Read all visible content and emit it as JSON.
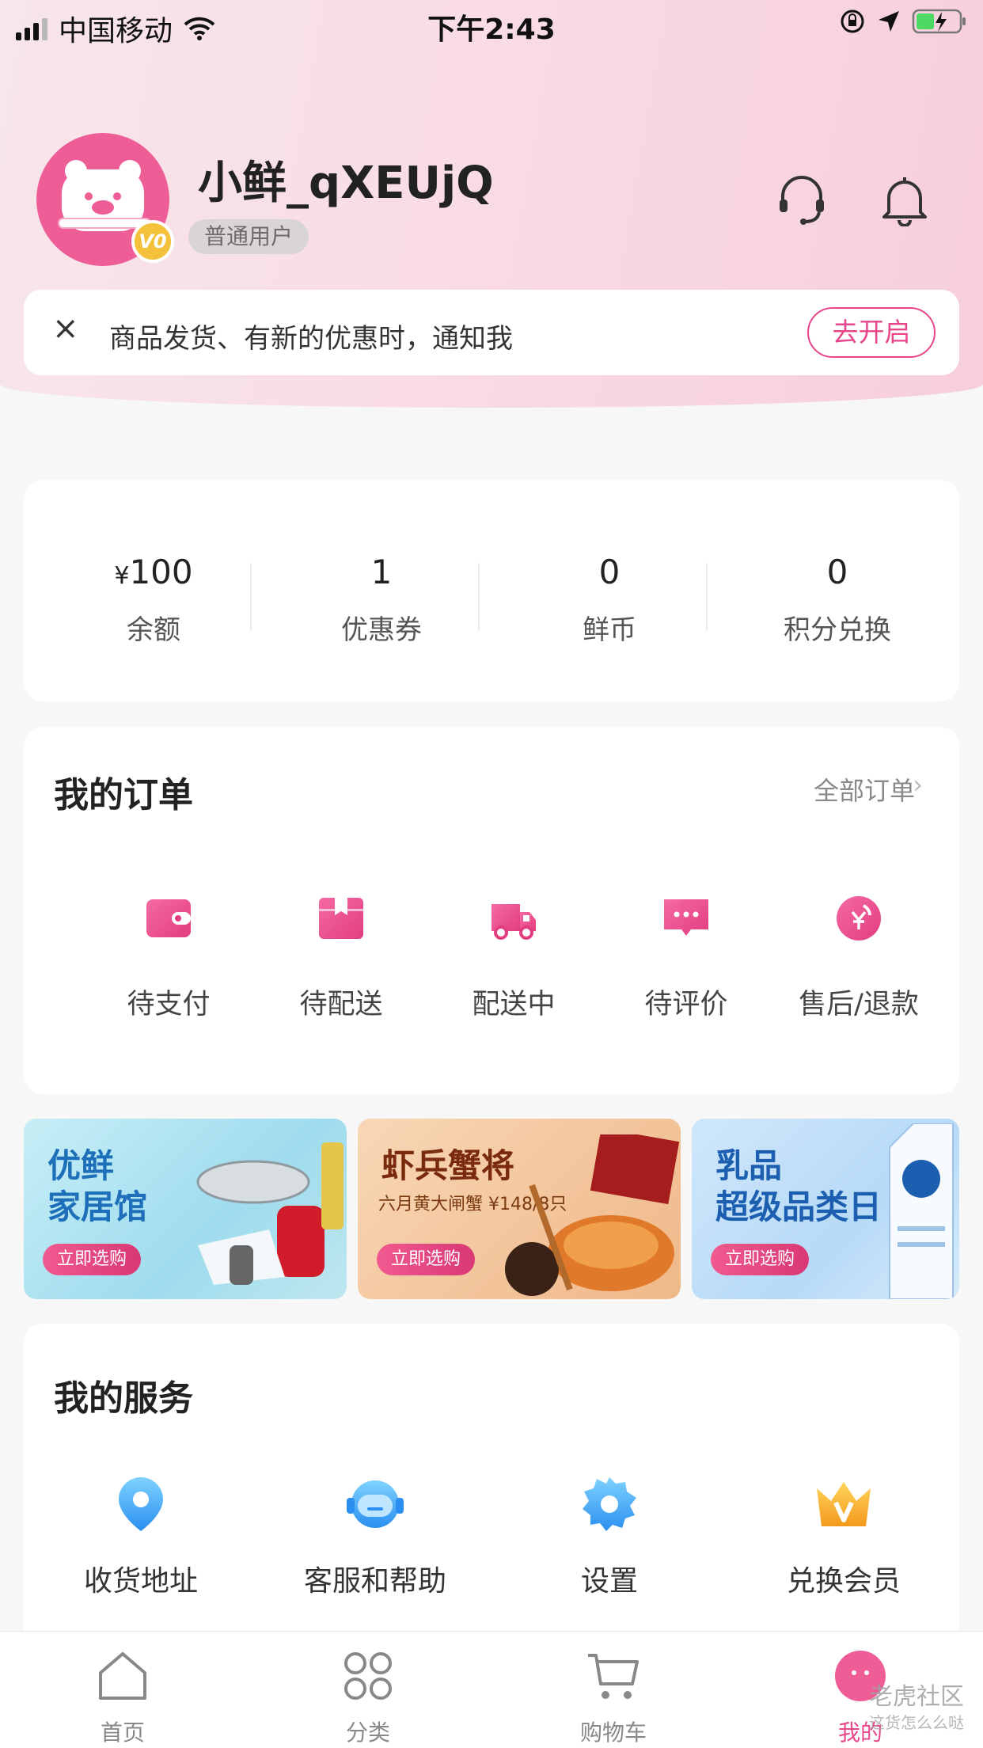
{
  "status_bar": {
    "carrier": "中国移动",
    "time": "下午2:43"
  },
  "profile": {
    "username": "小鲜_qXEUjQ",
    "user_type": "普通用户",
    "level": "V0"
  },
  "notify": {
    "text": "商品发货、有新的优惠时，通知我",
    "button": "去开启",
    "close": "×"
  },
  "assets": {
    "items": [
      {
        "currency": "¥",
        "value": "100",
        "label": "余额"
      },
      {
        "value": "1",
        "label": "优惠券"
      },
      {
        "value": "0",
        "label": "鲜币"
      },
      {
        "value": "0",
        "label": "积分兑换"
      }
    ]
  },
  "orders": {
    "title": "我的订单",
    "all_link": "全部订单",
    "items": [
      {
        "label": "待支付",
        "icon": "wallet-icon"
      },
      {
        "label": "待配送",
        "icon": "package-icon"
      },
      {
        "label": "配送中",
        "icon": "truck-icon"
      },
      {
        "label": "待评价",
        "icon": "comment-icon"
      },
      {
        "label": "售后/退款",
        "icon": "refund-icon"
      }
    ]
  },
  "banners": [
    {
      "title_line1": "优鲜",
      "title_line2": "家居馆",
      "button": "立即选购",
      "color": "#1c6fb8"
    },
    {
      "title_line1": "虾兵蟹将",
      "subtitle": "六月黄大闸蟹 ¥148/8只",
      "button": "立即选购",
      "color": "#7a2a0d"
    },
    {
      "title_line1": "乳品",
      "title_line2": "超级品类日",
      "button": "立即选购",
      "color": "#1c5fb0"
    }
  ],
  "services": {
    "title": "我的服务",
    "items": [
      {
        "label": "收货地址",
        "icon": "location-icon"
      },
      {
        "label": "客服和帮助",
        "icon": "support-robot-icon"
      },
      {
        "label": "设置",
        "icon": "settings-icon"
      },
      {
        "label": "兑换会员",
        "icon": "crown-icon"
      }
    ]
  },
  "tabbar": {
    "items": [
      {
        "label": "首页",
        "icon": "home-icon"
      },
      {
        "label": "分类",
        "icon": "category-icon"
      },
      {
        "label": "购物车",
        "icon": "cart-icon"
      },
      {
        "label": "我的",
        "icon": "profile-icon",
        "active": true
      }
    ]
  },
  "watermark": {
    "text": "老虎社区",
    "sub": "这货怎么么哒"
  },
  "colors": {
    "accent": "#e8468a",
    "hero_bg": "#f9dce6",
    "page_bg": "#f7f7f7"
  }
}
